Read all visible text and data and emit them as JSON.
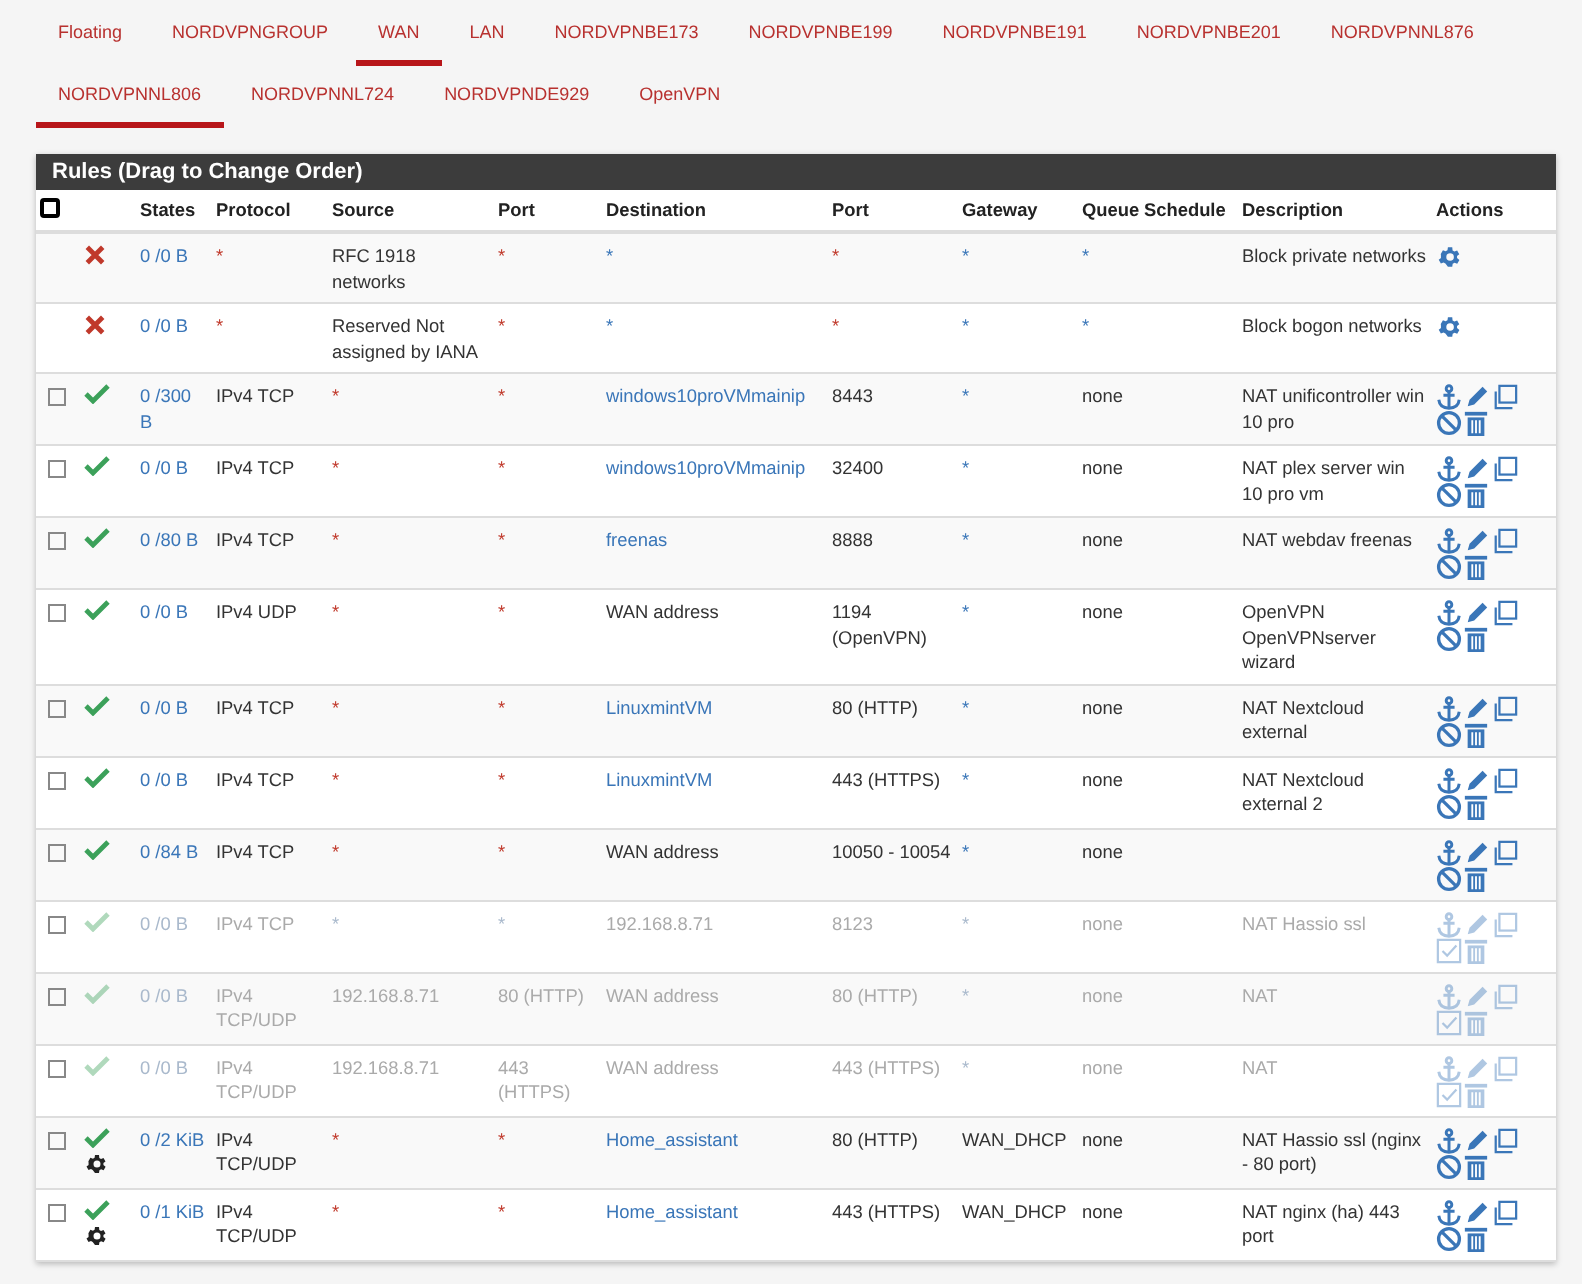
{
  "tabs": [
    {
      "label": "Floating",
      "selected": false
    },
    {
      "label": "NORDVPNGROUP",
      "selected": false
    },
    {
      "label": "WAN",
      "selected": true
    },
    {
      "label": "LAN",
      "selected": false
    },
    {
      "label": "NORDVPNBE173",
      "selected": false
    },
    {
      "label": "NORDVPNBE199",
      "selected": false
    },
    {
      "label": "NORDVPNBE191",
      "selected": false
    },
    {
      "label": "NORDVPNBE201",
      "selected": false
    },
    {
      "label": "NORDVPNNL876",
      "selected": false
    },
    {
      "label": "NORDVPNNL806",
      "selected": true
    },
    {
      "label": "NORDVPNNL724",
      "selected": false
    },
    {
      "label": "NORDVPNDE929",
      "selected": false
    },
    {
      "label": "OpenVPN",
      "selected": false
    }
  ],
  "panel": {
    "title": "Rules (Drag to Change Order)",
    "select_all_checked": false,
    "columns": [
      "States",
      "Protocol",
      "Source",
      "Port",
      "Destination",
      "Port",
      "Gateway",
      "Queue",
      "Schedule",
      "Description",
      "Actions"
    ],
    "rows": [
      {
        "kind": "block",
        "enabled": true,
        "advanced": false,
        "states": "0 /0 B",
        "protocol": "*",
        "source": "RFC 1918 networks",
        "source_port": "*",
        "destination": "*",
        "destination_port": "*",
        "gateway": "*",
        "queue": "*",
        "description": "Block private networks"
      },
      {
        "kind": "block",
        "enabled": true,
        "advanced": false,
        "states": "0 /0 B",
        "protocol": "*",
        "source": "Reserved Not assigned by IANA",
        "source_port": "*",
        "destination": "*",
        "destination_port": "*",
        "gateway": "*",
        "queue": "*",
        "description": "Block bogon networks"
      },
      {
        "kind": "pass",
        "checked": false,
        "enabled": true,
        "advanced": false,
        "states": "0 /300 B",
        "protocol": "IPv4 TCP",
        "source": "*",
        "source_port": "*",
        "destination": "windows10proVMmainip",
        "destination_link": true,
        "destination_port": "8443",
        "gateway": "*",
        "queue": "none",
        "description": "NAT unificontroller win 10 pro"
      },
      {
        "kind": "pass",
        "checked": false,
        "enabled": true,
        "advanced": false,
        "states": "0 /0 B",
        "protocol": "IPv4 TCP",
        "source": "*",
        "source_port": "*",
        "destination": "windows10proVMmainip",
        "destination_link": true,
        "destination_port": "32400",
        "gateway": "*",
        "queue": "none",
        "description": "NAT plex server win 10 pro vm"
      },
      {
        "kind": "pass",
        "checked": false,
        "enabled": true,
        "advanced": false,
        "states": "0 /80 B",
        "protocol": "IPv4 TCP",
        "source": "*",
        "source_port": "*",
        "destination": "freenas",
        "destination_link": true,
        "destination_port": "8888",
        "gateway": "*",
        "queue": "none",
        "description": "NAT webdav freenas"
      },
      {
        "kind": "pass",
        "checked": false,
        "enabled": true,
        "advanced": false,
        "states": "0 /0 B",
        "protocol": "IPv4 UDP",
        "source": "*",
        "source_port": "*",
        "destination": "WAN address",
        "destination_link": false,
        "destination_port": "1194 (OpenVPN)",
        "gateway": "*",
        "queue": "none",
        "description": "OpenVPN OpenVPNserver wizard"
      },
      {
        "kind": "pass",
        "checked": false,
        "enabled": true,
        "advanced": false,
        "states": "0 /0 B",
        "protocol": "IPv4 TCP",
        "source": "*",
        "source_port": "*",
        "destination": "LinuxmintVM",
        "destination_link": true,
        "destination_port": "80 (HTTP)",
        "gateway": "*",
        "queue": "none",
        "description": "NAT Nextcloud external"
      },
      {
        "kind": "pass",
        "checked": false,
        "enabled": true,
        "advanced": false,
        "states": "0 /0 B",
        "protocol": "IPv4 TCP",
        "source": "*",
        "source_port": "*",
        "destination": "LinuxmintVM",
        "destination_link": true,
        "destination_port": "443 (HTTPS)",
        "gateway": "*",
        "queue": "none",
        "description": "NAT Nextcloud external 2"
      },
      {
        "kind": "pass",
        "checked": false,
        "enabled": true,
        "advanced": false,
        "states": "0 /84 B",
        "protocol": "IPv4 TCP",
        "source": "*",
        "source_port": "*",
        "destination": "WAN address",
        "destination_link": false,
        "destination_port": "10050 - 10054",
        "gateway": "*",
        "queue": "none"
      },
      {
        "kind": "pass",
        "checked": false,
        "enabled": false,
        "advanced": false,
        "states": "0 /0 B",
        "protocol": "IPv4 TCP",
        "source": "*",
        "source_port": "*",
        "destination": "192.168.8.71",
        "destination_link": false,
        "destination_port": "8123",
        "gateway": "*",
        "queue": "none",
        "description": "NAT Hassio ssl"
      },
      {
        "kind": "pass",
        "checked": false,
        "enabled": false,
        "advanced": false,
        "states": "0 /0 B",
        "protocol": "IPv4 TCP/UDP",
        "source": "192.168.8.71",
        "source_port": "80 (HTTP)",
        "destination": "WAN address",
        "destination_link": false,
        "destination_port": "80 (HTTP)",
        "gateway": "*",
        "queue": "none",
        "description": "NAT"
      },
      {
        "kind": "pass",
        "checked": false,
        "enabled": false,
        "advanced": false,
        "states": "0 /0 B",
        "protocol": "IPv4 TCP/UDP",
        "source": "192.168.8.71",
        "source_port": "443 (HTTPS)",
        "destination": "WAN address",
        "destination_link": false,
        "destination_port": "443 (HTTPS)",
        "gateway": "*",
        "queue": "none",
        "description": "NAT"
      },
      {
        "kind": "pass",
        "checked": false,
        "enabled": true,
        "advanced": true,
        "states": "0 /2 KiB",
        "protocol": "IPv4 TCP/UDP",
        "source": "*",
        "source_port": "*",
        "destination": "Home_assistant",
        "destination_link": true,
        "destination_port": "80 (HTTP)",
        "gateway": "WAN_DHCP",
        "queue": "none",
        "description": "NAT Hassio ssl (nginx - 80 port)"
      },
      {
        "kind": "pass",
        "checked": false,
        "enabled": true,
        "advanced": true,
        "states": "0 /1 KiB",
        "protocol": "IPv4 TCP/UDP",
        "source": "*",
        "source_port": "*",
        "destination": "Home_assistant",
        "destination_link": true,
        "destination_port": "443 (HTTPS)",
        "gateway": "WAN_DHCP",
        "queue": "none",
        "description": "NAT nginx (ha) 443 port"
      }
    ]
  }
}
